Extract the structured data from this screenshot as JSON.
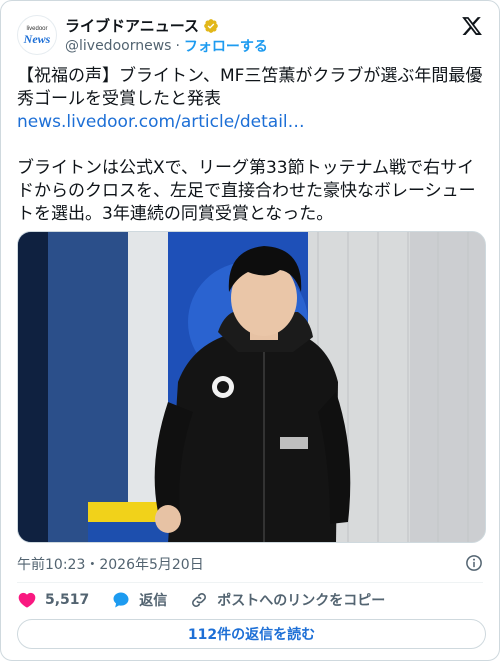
{
  "account": {
    "avatar_top": "livedoor",
    "avatar_bottom": "News",
    "name": "ライブドアニュース",
    "handle": "@livedoornews",
    "separator": "·",
    "follow_label": "フォローする"
  },
  "tweet": {
    "headline": "【祝福の声】ブライトン、MF三笘薫がクラブが選ぶ年間最優秀ゴールを受賞したと発表",
    "link_text": "news.livedoor.com/article/detail…",
    "body": "ブライトンは公式Xで、リーグ第33節トッテナム戦で右サイドからのクロスを、左足で直接合わせた豪快なボレーシュートを選出。3年連続の同賞受賞となった。"
  },
  "meta": {
    "timestamp": "午前10:23・2026年5月20日"
  },
  "actions": {
    "likes": "5,517",
    "reply_label": "返信",
    "copy_link_label": "ポストへのリンクをコピー"
  },
  "replies_button": "112件の返信を読む",
  "colors": {
    "accent": "#1d9bf0",
    "like": "#f91880",
    "verified": "#e2b719"
  },
  "icons": [
    "verified-badge-icon",
    "x-logo-icon",
    "heart-icon",
    "reply-bubble-icon",
    "link-icon",
    "info-icon"
  ]
}
